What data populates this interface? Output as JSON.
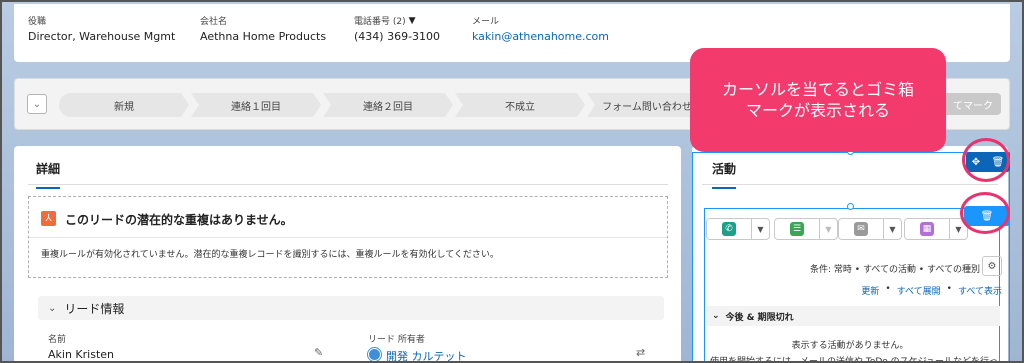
{
  "highlights": {
    "title_label": "役職",
    "title_value": "Director, Warehouse Mgmt",
    "company_label": "会社名",
    "company_value": "Aethna Home Products",
    "phone_label": "電話番号 (2)",
    "phone_value": "(434) 369-3100",
    "email_label": "メール",
    "email_value": "kakin@athenahome.com"
  },
  "path": {
    "steps": [
      "新規",
      "連絡１回目",
      "連絡２回目",
      "不成立",
      "フォーム問い合わせ"
    ],
    "mark_button": "完了としてマーク",
    "mark_button_visible": "てマーク"
  },
  "detail": {
    "tab": "詳細",
    "dup_title": "このリードの潜在的な重複はありません。",
    "dup_text": "重複ルールが有効化されていません。潜在的な重複レコードを識別するには、重複ルールを有効化してください。",
    "section_title": "リード情報",
    "name_label": "名前",
    "name_value": "Akin Kristen",
    "owner_label": "リード 所有者",
    "owner_value": "開発 カルテット"
  },
  "activity": {
    "tab": "活動",
    "filter_text": "条件: 常時 • すべての活動 • すべての種別",
    "links": [
      "更新",
      "すべて展開",
      "すべて表示"
    ],
    "upcoming": "今後 & 期限切れ",
    "no_activity": "表示する活動がありません。",
    "no_activity_hint": "使用を開始するには、メールの送信や ToDo のスケジュールなどを行っ"
  },
  "callout": {
    "line1": "カーソルを当てるとゴミ箱",
    "line2": "マークが表示される"
  },
  "colors": {
    "accent": "#0b66b8",
    "callout": "#f23a6d",
    "ring": "#e8336e",
    "call_icon": "#1e9f8a",
    "task_icon": "#3ba755",
    "email_icon": "#9a9a9a",
    "event_icon": "#b371d8"
  }
}
